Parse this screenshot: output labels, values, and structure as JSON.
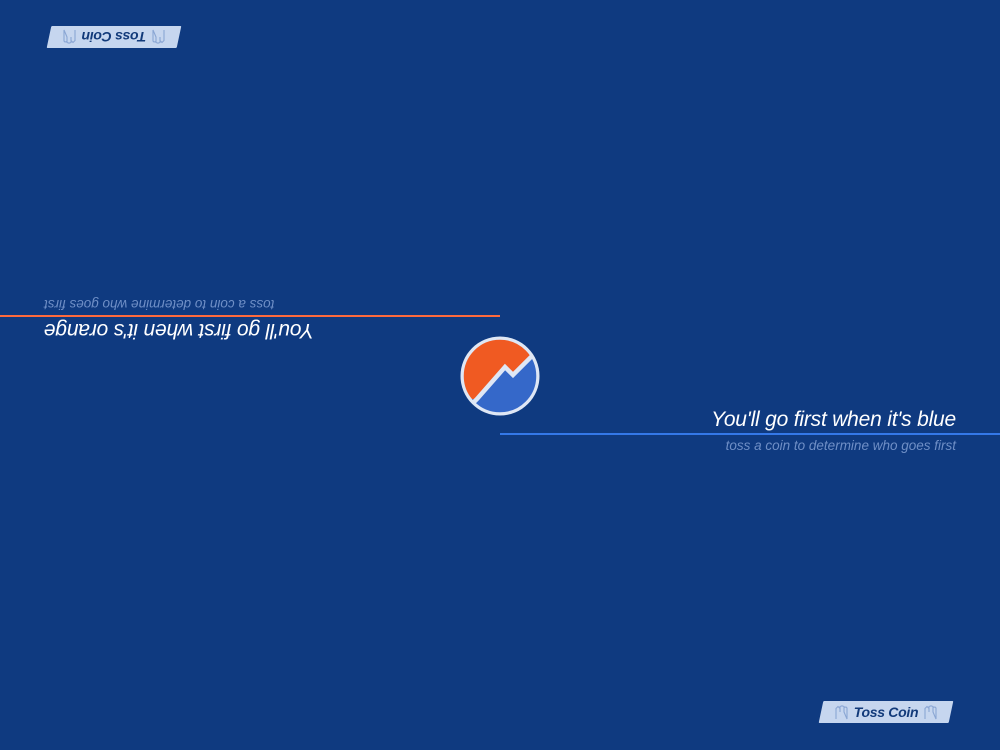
{
  "players": {
    "bottom": {
      "title": "You'll go first when it's blue",
      "subtitle": "toss a coin to determine who goes first",
      "divider_color": "#3478e8"
    },
    "top": {
      "title": "You'll go first when it's orange",
      "subtitle": "toss a coin to determine who goes first",
      "divider_color": "#ff6a3d"
    }
  },
  "buttons": {
    "toss_label": "Toss Coin",
    "icon": "hand-icon"
  },
  "coin": {
    "orange": "#f05a22",
    "blue": "#3568c9",
    "icon": "coin-icon"
  },
  "colors": {
    "background": "#0f3a80",
    "button_bg": "#c6d6ef",
    "button_text": "#123a7a"
  }
}
